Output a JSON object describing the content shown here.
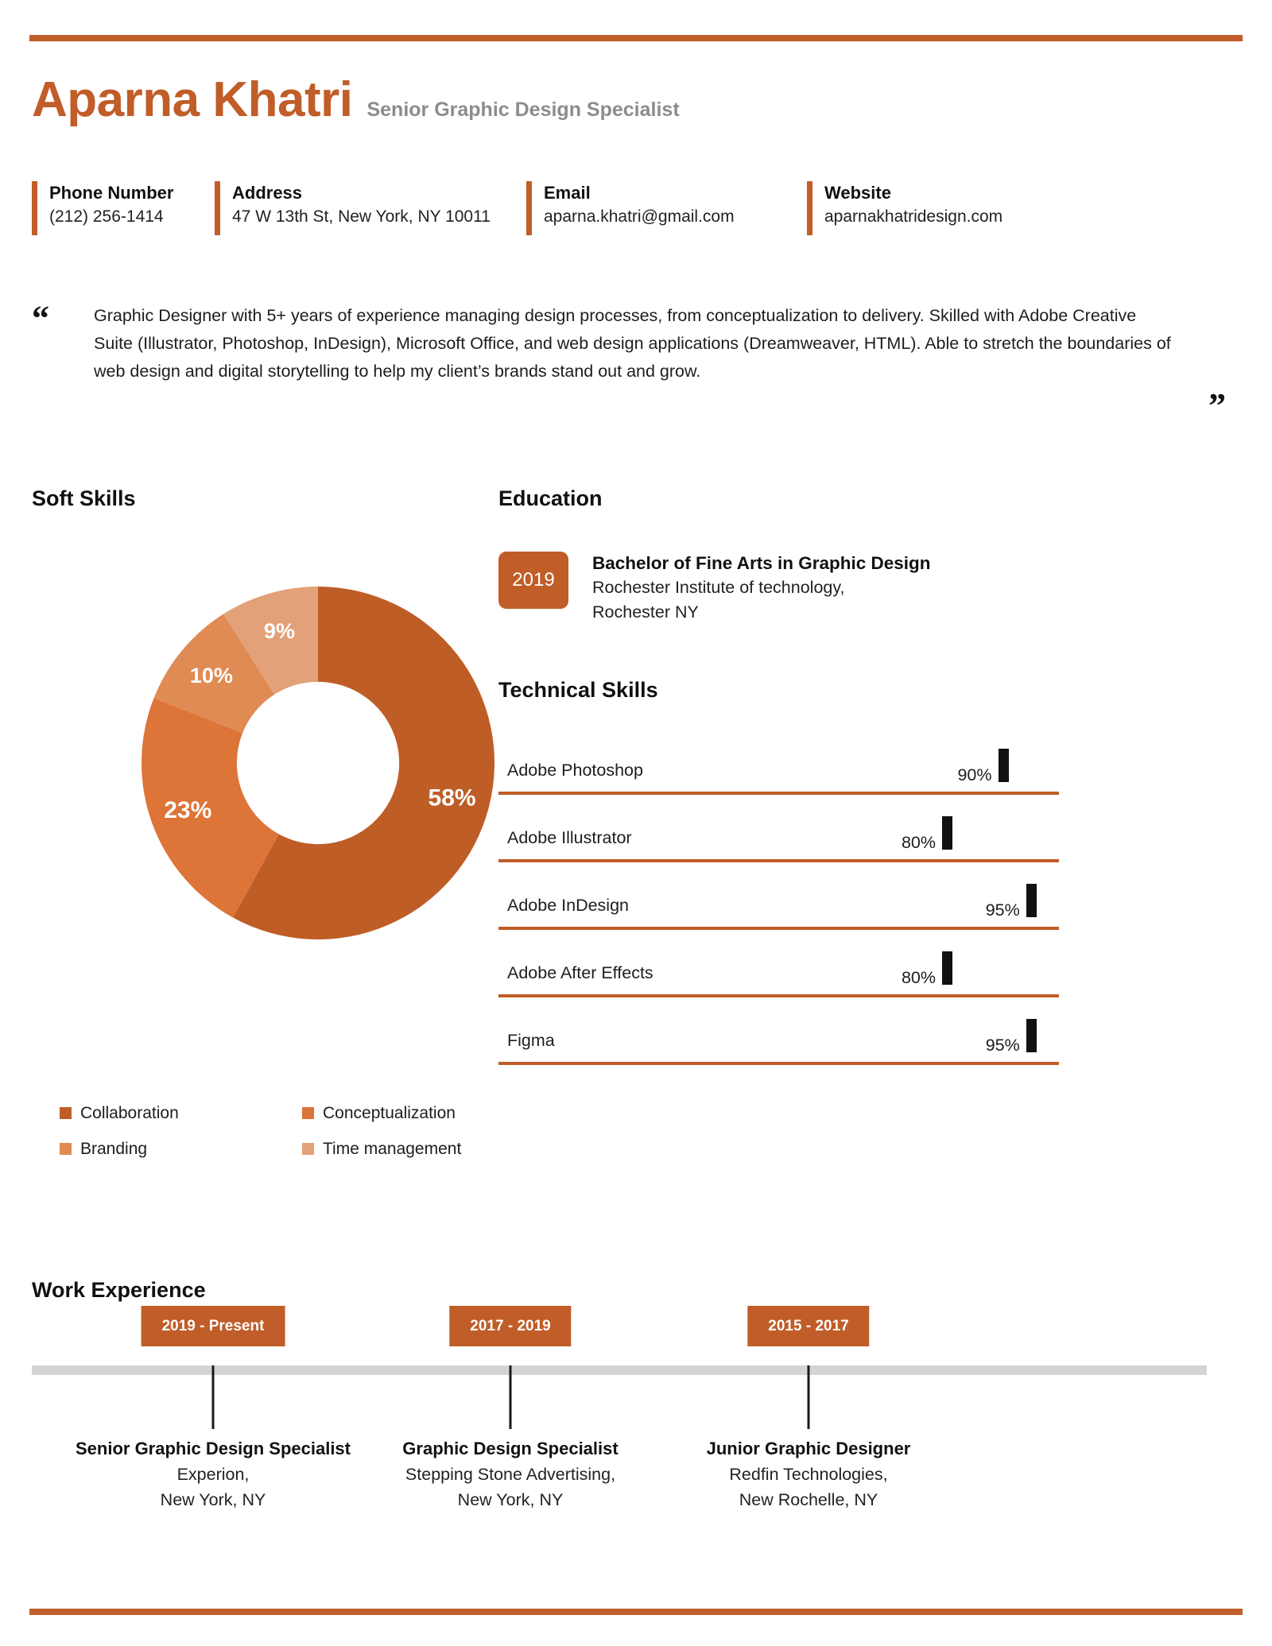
{
  "theme": {
    "accent": "#C05D28",
    "muted": "#8c8c8c",
    "timeline_bar": "#d4d4d4"
  },
  "header": {
    "name": "Aparna Khatri",
    "role": "Senior Graphic Design Specialist"
  },
  "contacts": [
    {
      "label": "Phone Number",
      "value": "(212) 256-1414"
    },
    {
      "label": "Address",
      "value": "47 W 13th St, New York, NY 10011"
    },
    {
      "label": "Email",
      "value": "aparna.khatri@gmail.com"
    },
    {
      "label": "Website",
      "value": "aparnakhatridesign.com"
    }
  ],
  "summary": {
    "quote_open": "“",
    "quote_close": "”",
    "text": "Graphic Designer with 5+ years of experience managing design processes, from conceptualization to delivery. Skilled with Adobe Creative Suite (Illustrator, Photoshop, InDesign), Microsoft Office, and web design applications (Dreamweaver, HTML). Able to stretch the boundaries of web design and digital storytelling to help my client’s brands stand out and grow."
  },
  "soft_skills": {
    "title": "Soft Skills"
  },
  "chart_data": {
    "type": "pie",
    "title": "Soft Skills",
    "donut": true,
    "inner_radius_ratio": 0.46,
    "legend_position": "bottom",
    "categories": [
      "Collaboration",
      "Conceptualization",
      "Branding",
      "Time management"
    ],
    "values": [
      58,
      23,
      10,
      9
    ],
    "labels": [
      "58%",
      "23%",
      "10%",
      "9%"
    ],
    "colors": [
      "#BF5D27",
      "#DD7438",
      "#E08B53",
      "#E2A179"
    ],
    "units": "%",
    "start_angle": 0
  },
  "education": {
    "title": "Education",
    "items": [
      {
        "year": "2019",
        "degree": "Bachelor of Fine Arts in Graphic Design",
        "school_line1": "Rochester Institute of technology,",
        "school_line2": "Rochester NY"
      }
    ]
  },
  "technical_skills": {
    "title": "Technical Skills",
    "items": [
      {
        "name": "Adobe Photoshop",
        "percent": "90%",
        "value": 90
      },
      {
        "name": "Adobe Illustrator",
        "percent": "80%",
        "value": 80
      },
      {
        "name": "Adobe InDesign",
        "percent": "95%",
        "value": 95
      },
      {
        "name": "Adobe After Effects",
        "percent": "80%",
        "value": 80
      },
      {
        "name": "Figma",
        "percent": "95%",
        "value": 95
      }
    ]
  },
  "work_experience": {
    "title": "Work Experience",
    "items": [
      {
        "period": "2019 - Present",
        "role": "Senior Graphic Design Specialist",
        "company_line1": "Experion,",
        "company_line2": "New York, NY"
      },
      {
        "period": "2017 - 2019",
        "role": "Graphic Design Specialist",
        "company_line1": "Stepping Stone Advertising,",
        "company_line2": "New York, NY"
      },
      {
        "period": "2015 - 2017",
        "role": "Junior Graphic Designer",
        "company_line1": "Redfin Technologies,",
        "company_line2": "New Rochelle, NY"
      }
    ]
  }
}
